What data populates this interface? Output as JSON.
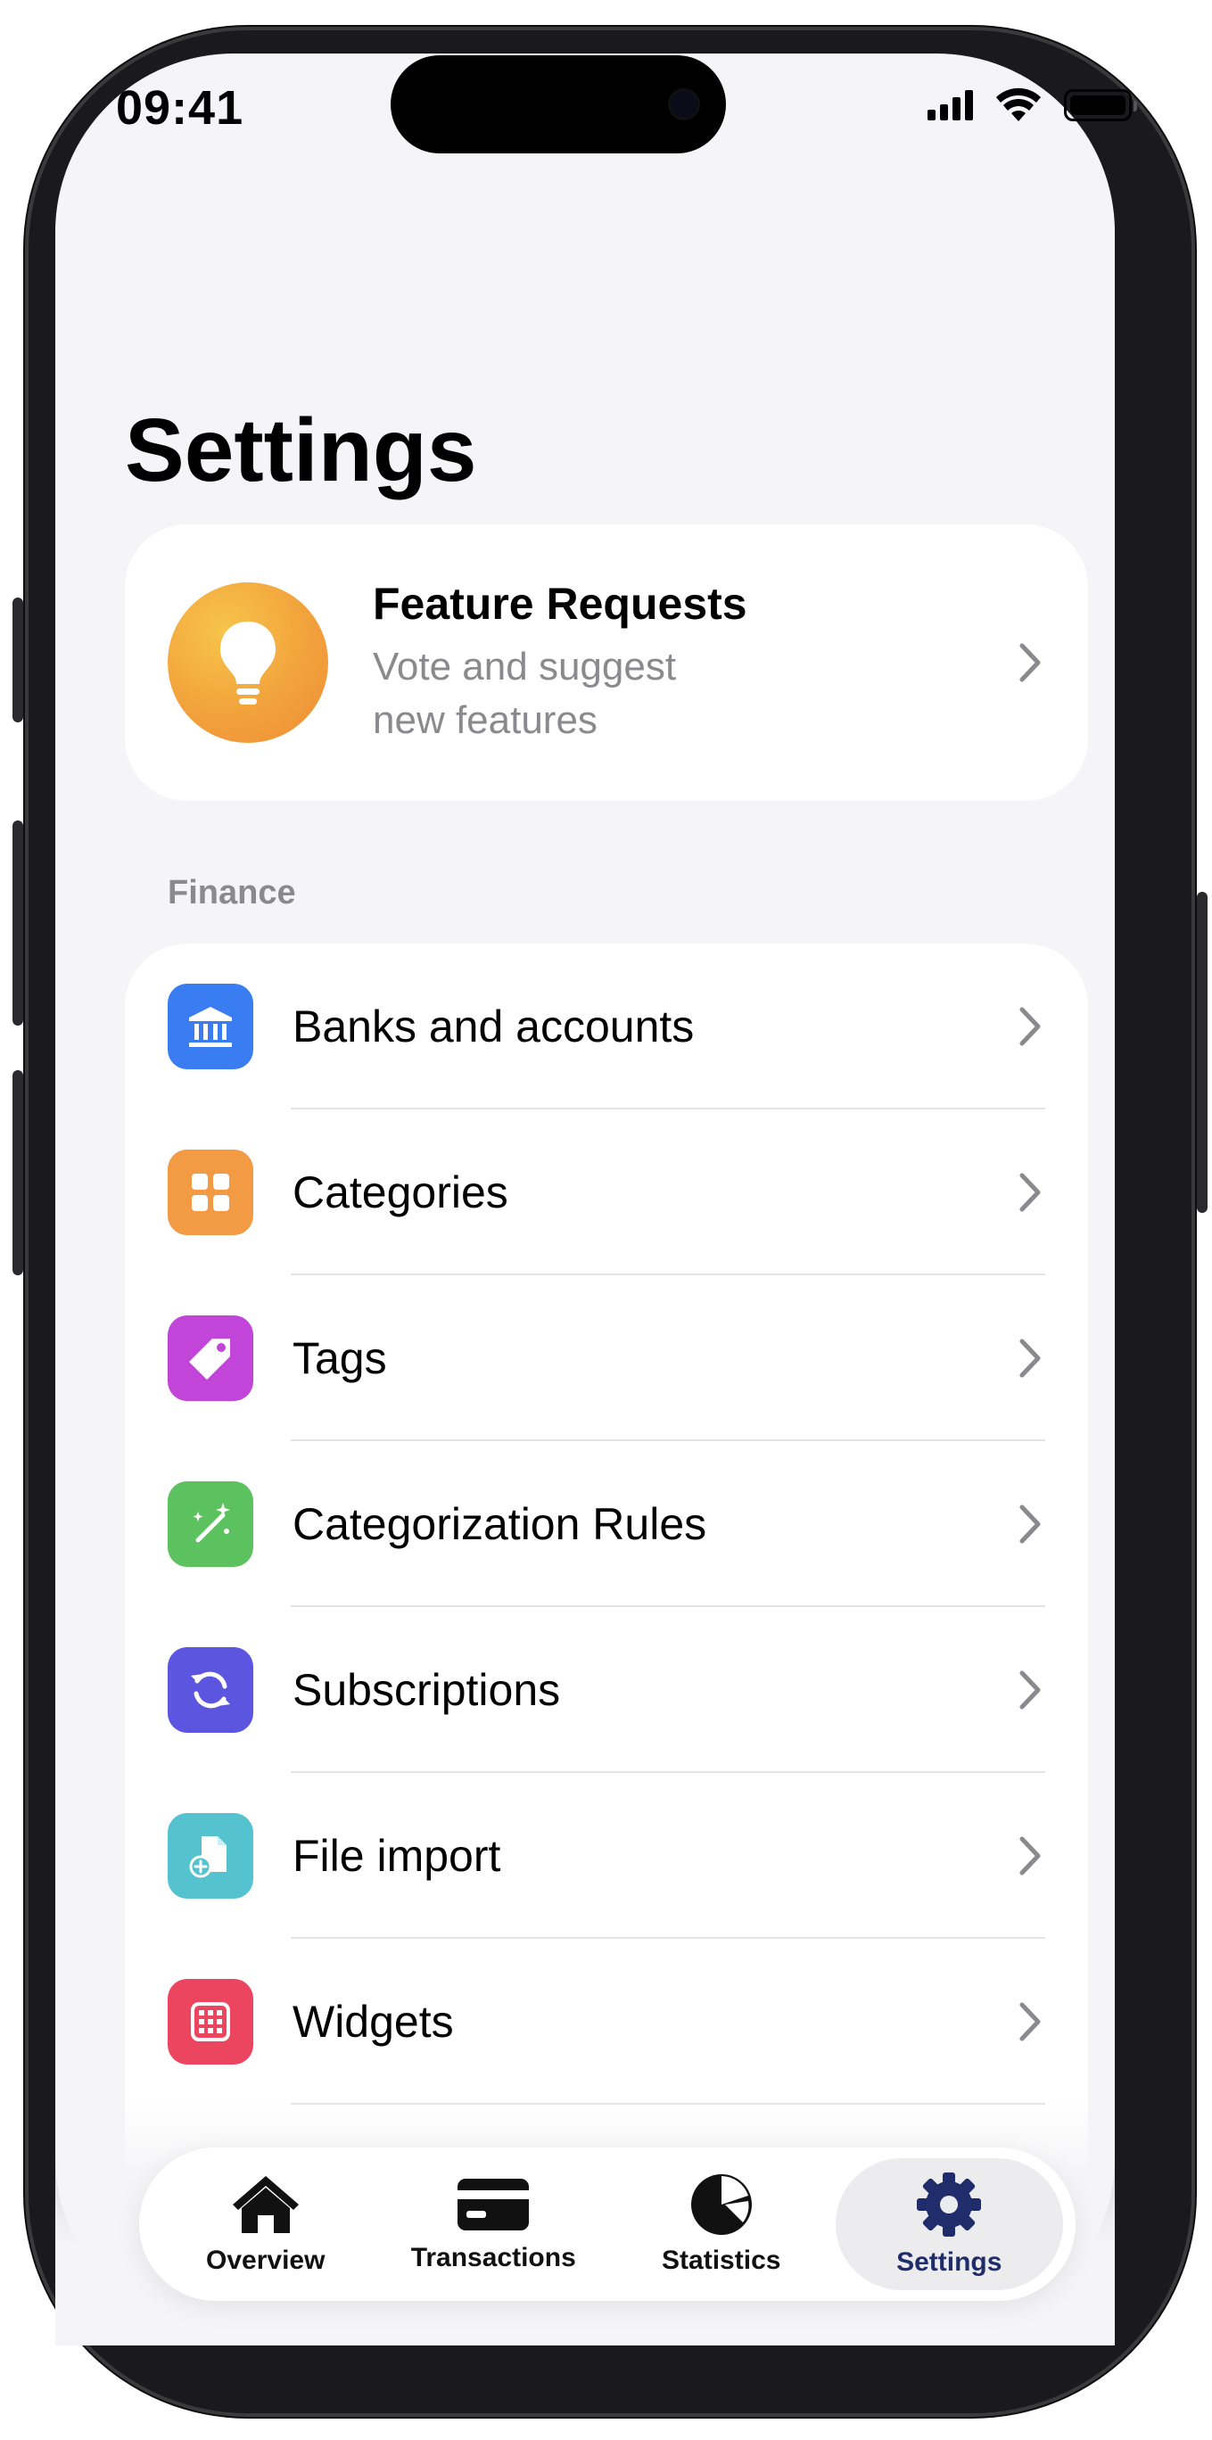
{
  "status_bar": {
    "time": "09:41"
  },
  "page": {
    "title": "Settings"
  },
  "feature_card": {
    "title": "Feature Requests",
    "subtitle": "Vote and suggest new features",
    "icon": "lightbulb-icon"
  },
  "finance": {
    "section_label": "Finance",
    "items": [
      {
        "label": "Banks and accounts",
        "icon": "bank-icon",
        "color": "#3a7df2"
      },
      {
        "label": "Categories",
        "icon": "grid-icon",
        "color": "#f29a44"
      },
      {
        "label": "Tags",
        "icon": "tag-icon",
        "color": "#c045d8"
      },
      {
        "label": "Categorization Rules",
        "icon": "magic-wand-icon",
        "color": "#5cc15f"
      },
      {
        "label": "Subscriptions",
        "icon": "refresh-icon",
        "color": "#5b55e0"
      },
      {
        "label": "File import",
        "icon": "file-add-icon",
        "color": "#55c3cf"
      },
      {
        "label": "Widgets",
        "icon": "widget-grid-icon",
        "color": "#ec4560"
      }
    ]
  },
  "tab_bar": {
    "tabs": [
      {
        "label": "Overview",
        "icon": "house-icon",
        "active": false
      },
      {
        "label": "Transactions",
        "icon": "card-icon",
        "active": false
      },
      {
        "label": "Statistics",
        "icon": "pie-chart-icon",
        "active": false
      },
      {
        "label": "Settings",
        "icon": "gear-icon",
        "active": true
      }
    ],
    "active_color": "#1f2d6b"
  }
}
